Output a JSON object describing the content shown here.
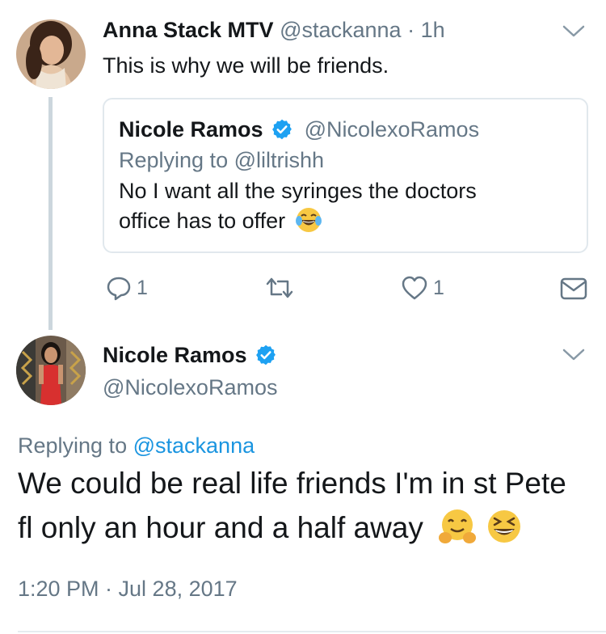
{
  "tweet1": {
    "name": "Anna Stack MTV",
    "handle": "@stackanna",
    "separator": "·",
    "time": "1h",
    "text": "This is why we will be friends."
  },
  "quoted": {
    "name": "Nicole Ramos",
    "handle": "@NicolexoRamos",
    "replying_prefix": "Replying to",
    "replying_handle": "@liltrishh",
    "text_line1": "No I want all the syringes the doctors",
    "text_line2": "office has to offer"
  },
  "actions": {
    "reply_count": "1",
    "like_count": "1"
  },
  "tweet2": {
    "name": "Nicole Ramos",
    "handle": "@NicolexoRamos",
    "replying_prefix": "Replying to",
    "replying_handle": "@stackanna",
    "text_line1": "We could be real life friends I'm in st Pete",
    "text_line2": "fl only an hour and a half away",
    "timestamp": "1:20 PM · Jul 28, 2017"
  },
  "colors": {
    "accent": "#1b95e0",
    "secondary_text": "#657786",
    "border": "#e1e8ed"
  },
  "icons": [
    "chevron-down-icon",
    "verified-badge-icon",
    "reply-icon",
    "retweet-icon",
    "like-icon",
    "direct-message-icon",
    "laughing-tears-emoji",
    "hugging-face-emoji",
    "grinning-squinting-emoji"
  ]
}
